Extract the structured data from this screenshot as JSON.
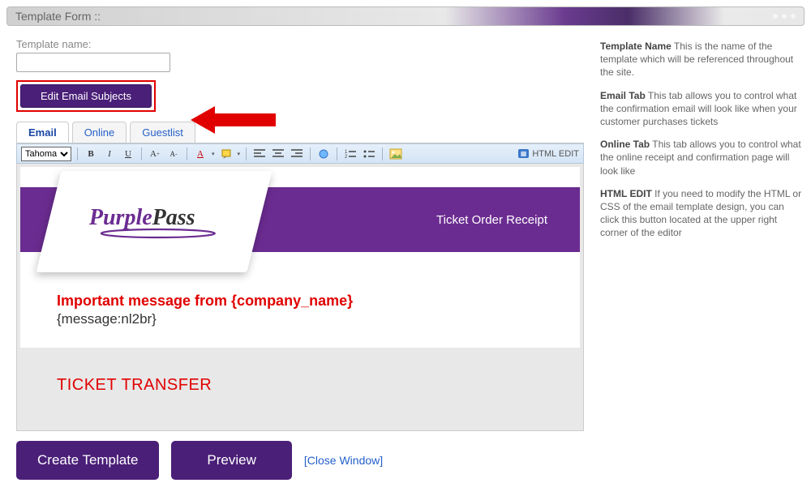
{
  "header": {
    "title": "Template Form ::"
  },
  "form": {
    "template_name_label": "Template name:",
    "template_name_value": "",
    "edit_subjects_button": "Edit Email Subjects"
  },
  "tabs": [
    {
      "label": "Email",
      "active": true
    },
    {
      "label": "Online",
      "active": false
    },
    {
      "label": "Guestlist",
      "active": false
    }
  ],
  "toolbar": {
    "font_name": "Tahoma",
    "html_edit_label": "HTML EDIT"
  },
  "email_preview": {
    "logo_part1": "Purple",
    "logo_part2": "Pass",
    "receipt_title": "Ticket Order Receipt",
    "important_line": "Important message from {company_name}",
    "message_token": "{message:nl2br}",
    "ticket_transfer": "TICKET TRANSFER"
  },
  "buttons": {
    "create": "Create Template",
    "preview": "Preview",
    "close": "[Close Window]"
  },
  "help": {
    "p1_title": "Template Name",
    "p1_text": " This is the name of the template which will be referenced throughout the site.",
    "p2_title": "Email Tab",
    "p2_text": " This tab allows you to control what the confirmation email will look like when your customer purchases tickets",
    "p3_title": "Online Tab",
    "p3_text": " This tab allows you to control what the online receipt and confirmation page will look like",
    "p4_title": "HTML EDIT",
    "p4_text": " If you need to modify the HTML or CSS of the email template design, you can click this button located at the upper right corner of the editor"
  }
}
